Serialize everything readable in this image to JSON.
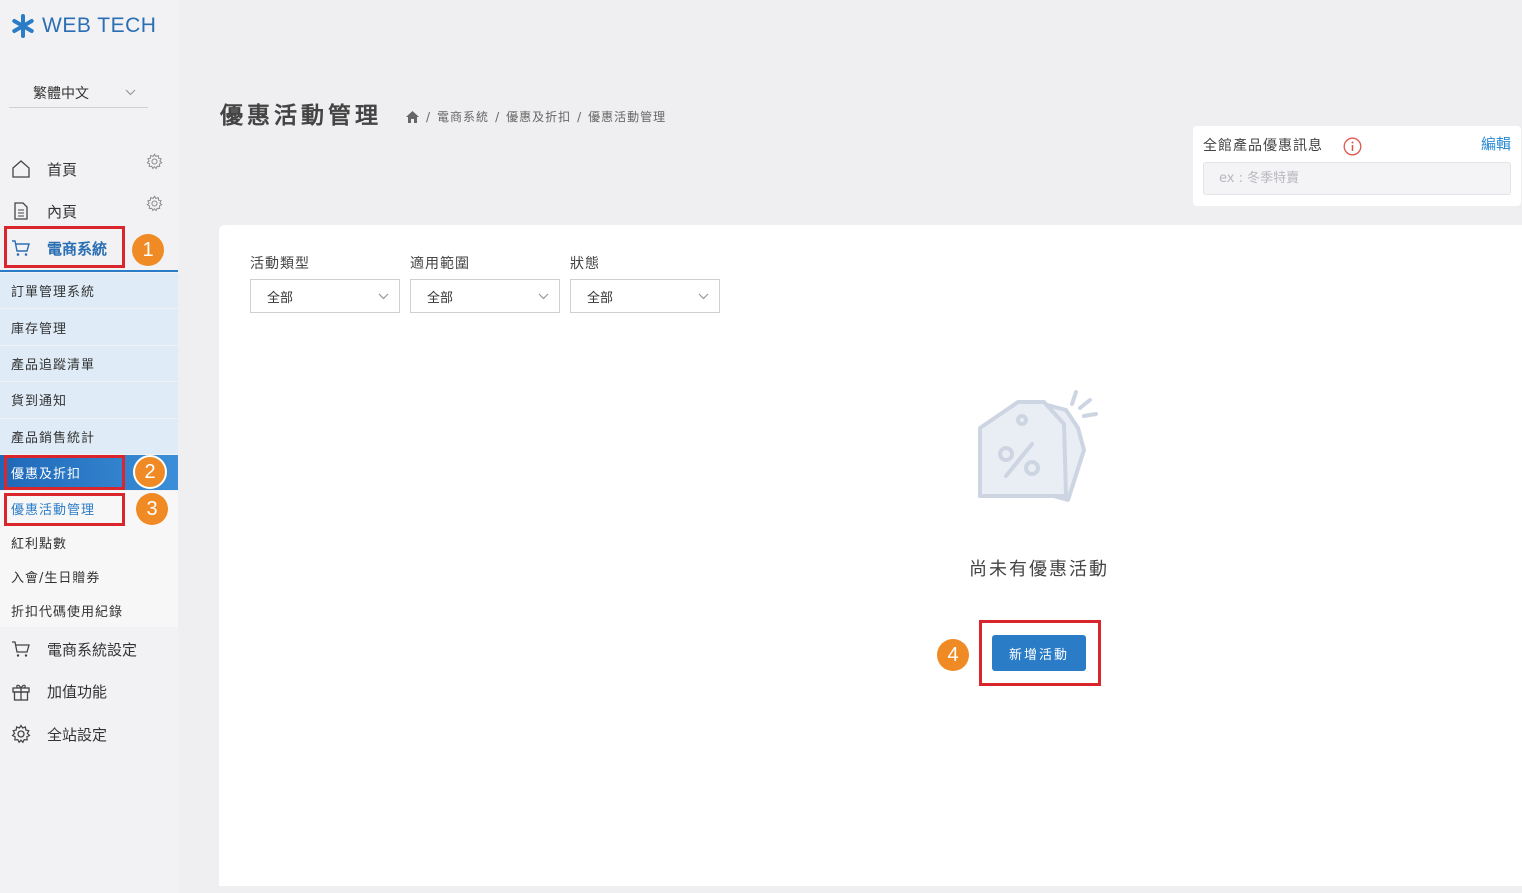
{
  "logo": {
    "text": "WEB TECH"
  },
  "language": {
    "selected": "繁體中文"
  },
  "nav": {
    "home": "首頁",
    "inner": "內頁",
    "ecommerce": "電商系統",
    "ecommerce_settings": "電商系統設定",
    "addons": "加值功能",
    "site_settings": "全站設定"
  },
  "submenu": [
    {
      "label": "訂單管理系統"
    },
    {
      "label": "庫存管理"
    },
    {
      "label": "產品追蹤清單"
    },
    {
      "label": "貨到通知"
    },
    {
      "label": "產品銷售統計"
    },
    {
      "label": "優惠及折扣"
    }
  ],
  "subsubmenu": [
    {
      "label": "優惠活動管理"
    },
    {
      "label": "紅利點數"
    },
    {
      "label": "入會/生日贈券"
    },
    {
      "label": "折扣代碼使用紀錄"
    }
  ],
  "page": {
    "title": "優惠活動管理"
  },
  "breadcrumb": {
    "items": [
      "電商系統",
      "優惠及折扣",
      "優惠活動管理"
    ],
    "separator": "/"
  },
  "promo": {
    "label": "全館產品優惠訊息",
    "edit": "編輯",
    "input_value": "",
    "placeholder": "ex : 冬季特賣"
  },
  "filters": [
    {
      "label": "活動類型",
      "value": "全部"
    },
    {
      "label": "適用範圍",
      "value": "全部"
    },
    {
      "label": "狀態",
      "value": "全部"
    }
  ],
  "empty": {
    "message": "尚未有優惠活動",
    "button": "新增活動"
  },
  "annotations": [
    "1",
    "2",
    "3",
    "4"
  ],
  "colors": {
    "accent": "#2a7cc7",
    "highlight": "#d9262c",
    "badge": "#f08a24"
  }
}
